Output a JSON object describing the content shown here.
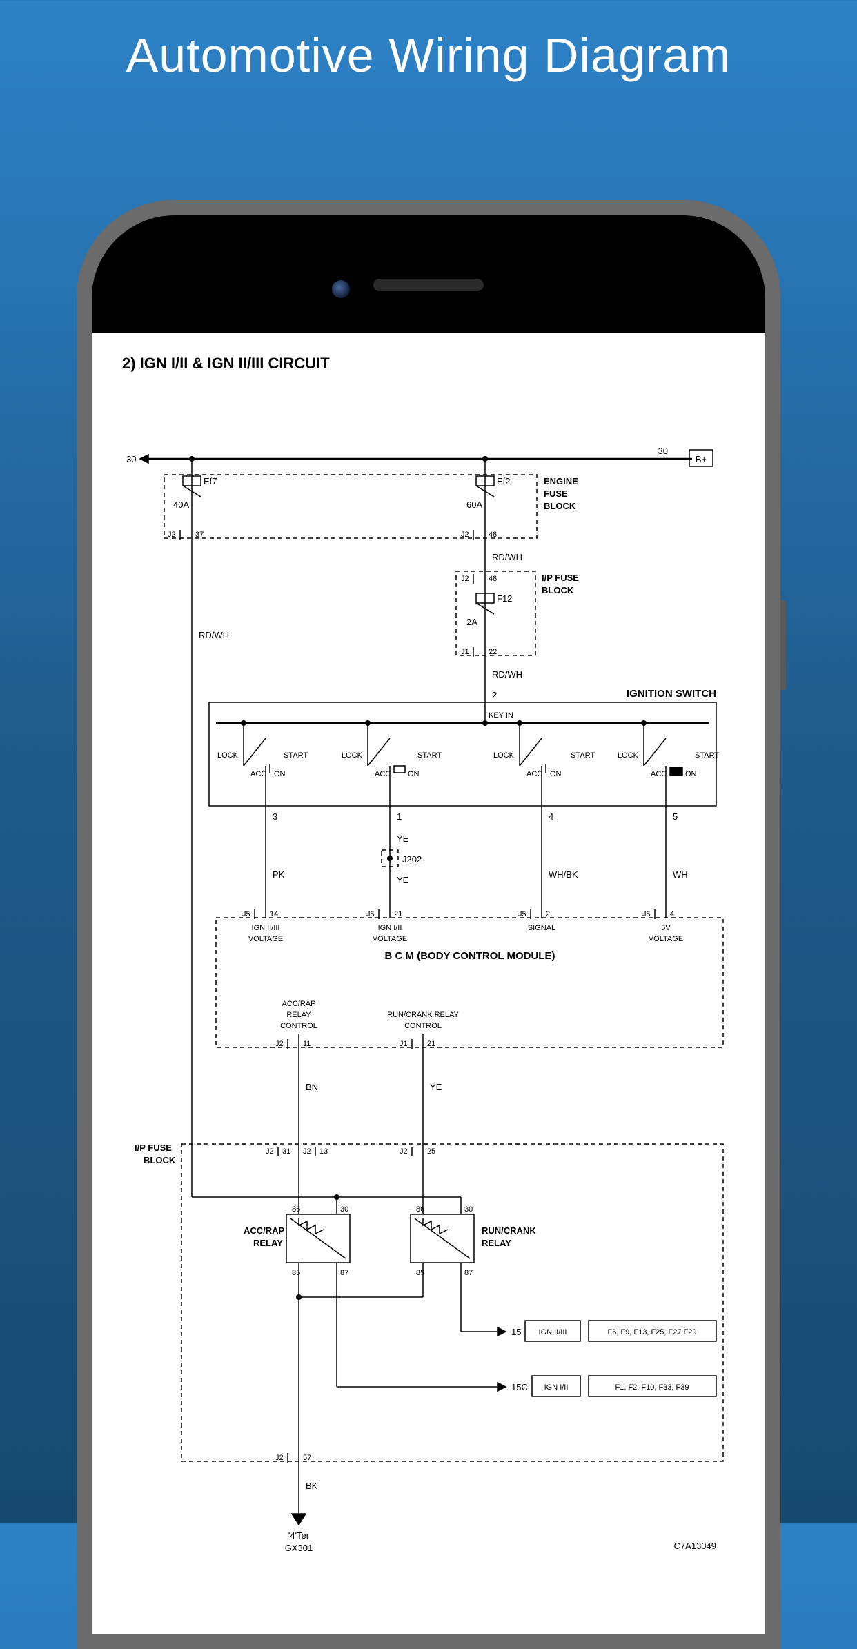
{
  "page": {
    "title": "Automotive Wiring Diagram"
  },
  "doc": {
    "section_title": "2) IGN I/II & IGN II/III CIRCUIT",
    "ref_id": "C7A13049"
  },
  "rail": {
    "left_label": "30",
    "right_label": "30",
    "bplus": "B+"
  },
  "engine_fuse_block": {
    "title_l1": "ENGINE",
    "title_l2": "FUSE",
    "title_l3": "BLOCK",
    "fuse1": {
      "name": "Ef7",
      "rating": "40A",
      "out_conn": "J2",
      "out_pin": "37"
    },
    "fuse2": {
      "name": "Ef2",
      "rating": "60A",
      "out_conn": "J2",
      "out_pin": "48"
    }
  },
  "wire": {
    "rdwh1": "RD/WH",
    "rdwh2": "RD/WH",
    "rdwh3": "RD/WH",
    "pk": "PK",
    "ye1": "YE",
    "ye2": "YE",
    "ye3": "YE",
    "whbk": "WH/BK",
    "wh": "WH",
    "bn": "BN",
    "bk": "BK"
  },
  "ip_fuse_upper": {
    "title_l1": "I/P FUSE",
    "title_l2": "BLOCK",
    "in_conn": "J2",
    "in_pin": "48",
    "fuse": {
      "name": "F12",
      "rating": "2A"
    },
    "out_conn": "J1",
    "out_pin": "22"
  },
  "ignition_switch": {
    "title": "IGNITION SWITCH",
    "key_in": "KEY IN",
    "pin2": "2",
    "positions": {
      "lock": "LOCK",
      "acc": "ACC",
      "on": "ON",
      "start": "START"
    },
    "out3": "3",
    "out1": "1",
    "out4": "4",
    "out5": "5"
  },
  "bcm": {
    "title": "B C M (BODY CONTROL MODULE)",
    "j202": "J202",
    "in1": {
      "conn": "J5",
      "pin": "14",
      "label_l1": "IGN II/III",
      "label_l2": "VOLTAGE"
    },
    "in2": {
      "conn": "J5",
      "pin": "21",
      "label_l1": "IGN I/II",
      "label_l2": "VOLTAGE"
    },
    "in3": {
      "conn": "J5",
      "pin": "2",
      "label": "SIGNAL"
    },
    "in4": {
      "conn": "J5",
      "pin": "4",
      "label_l1": "5V",
      "label_l2": "VOLTAGE"
    },
    "out1": {
      "label_l1": "ACC/RAP",
      "label_l2": "RELAY",
      "label_l3": "CONTROL",
      "conn": "J2",
      "pin": "11"
    },
    "out2": {
      "label_l1": "RUN/CRANK RELAY",
      "label_l2": "CONTROL",
      "conn": "J1",
      "pin": "21"
    }
  },
  "ip_fuse_lower": {
    "title_l1": "I/P FUSE",
    "title_l2": "BLOCK",
    "in_ign": {
      "conn": "J2",
      "pin": "31"
    },
    "in_accrap": {
      "conn": "J2",
      "pin": "13"
    },
    "in_runcrank": {
      "conn": "J2",
      "pin": "25"
    },
    "relay1": {
      "name_l1": "ACC/RAP",
      "name_l2": "RELAY",
      "p86": "86",
      "p30": "30",
      "p85": "85",
      "p87": "87"
    },
    "relay2": {
      "name_l1": "RUN/CRANK",
      "name_l2": "RELAY",
      "p86": "86",
      "p30": "30",
      "p85": "85",
      "p87": "87"
    },
    "bus1": {
      "num": "15",
      "tag": "IGN II/III",
      "fuses": "F6, F9, F13, F25, F27 F29"
    },
    "bus2": {
      "num": "15C",
      "tag": "IGN I/II",
      "fuses": "F1, F2, F10, F33, F39"
    },
    "ground_out": {
      "conn": "J2",
      "pin": "57"
    }
  },
  "ground": {
    "label_l1": "'4'Ter",
    "label_l2": "GX301"
  }
}
